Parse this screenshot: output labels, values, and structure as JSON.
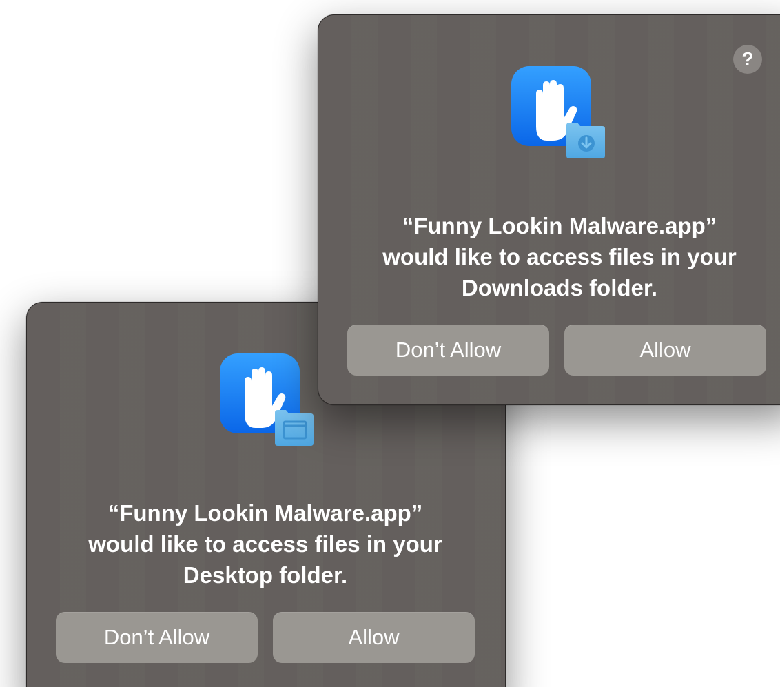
{
  "dialogs": {
    "downloads": {
      "help_label": "?",
      "message_line1": "“Funny Lookin Malware.app”",
      "message_line2": "would like to access files in your",
      "message_line3": "Downloads folder.",
      "deny_label": "Don’t Allow",
      "allow_label": "Allow",
      "icon": "hand-with-downloads-folder-icon"
    },
    "desktop": {
      "message_line1": "“Funny Lookin Malware.app”",
      "message_line2": "would like to access files in your",
      "message_line3": "Desktop folder.",
      "deny_label": "Don’t Allow",
      "allow_label": "Allow",
      "icon": "hand-with-desktop-folder-icon"
    }
  },
  "colors": {
    "dialog_background": "#645f5d",
    "button_background": "#9a9792",
    "icon_blue": "#1a7cf5",
    "folder_blue": "#5eb3ea"
  }
}
